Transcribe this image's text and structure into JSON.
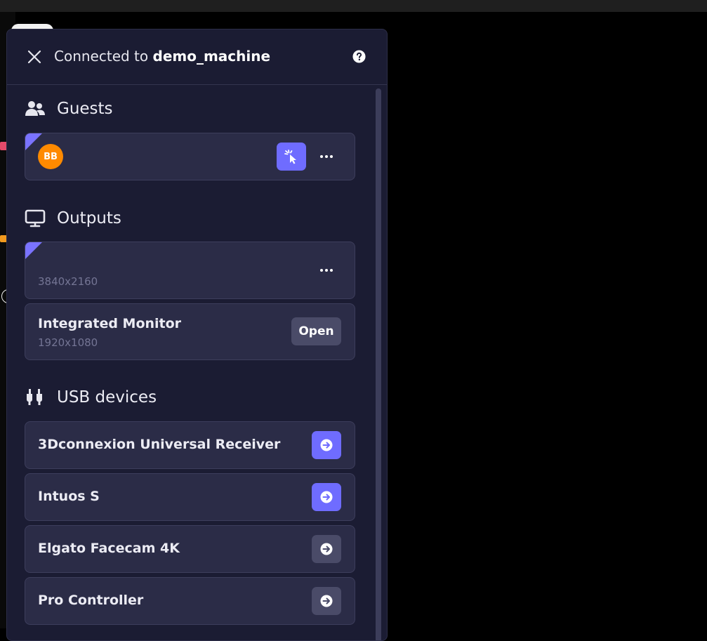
{
  "header": {
    "title_prefix": "Connected to",
    "machine_name": "demo_machine"
  },
  "guests": {
    "title": "Guests",
    "items": [
      {
        "initials": "BB",
        "avatar_color": "#ff8a00"
      }
    ]
  },
  "outputs": {
    "title": "Outputs",
    "items": [
      {
        "name": "",
        "resolution": "3840x2160"
      },
      {
        "name": "Integrated Monitor",
        "resolution": "1920x1080",
        "action_label": "Open"
      }
    ]
  },
  "usb": {
    "title": "USB devices",
    "items": [
      {
        "name": "3Dconnexion Universal Receiver",
        "state": "active"
      },
      {
        "name": "Intuos S",
        "state": "active"
      },
      {
        "name": "Elgato Facecam 4K",
        "state": "inactive"
      },
      {
        "name": "Pro Controller",
        "state": "inactive"
      }
    ]
  },
  "colors": {
    "panel_bg": "#1b1c33",
    "card_bg": "#2b2c47",
    "accent": "#6f6cff",
    "button_muted": "#4a4b68"
  }
}
